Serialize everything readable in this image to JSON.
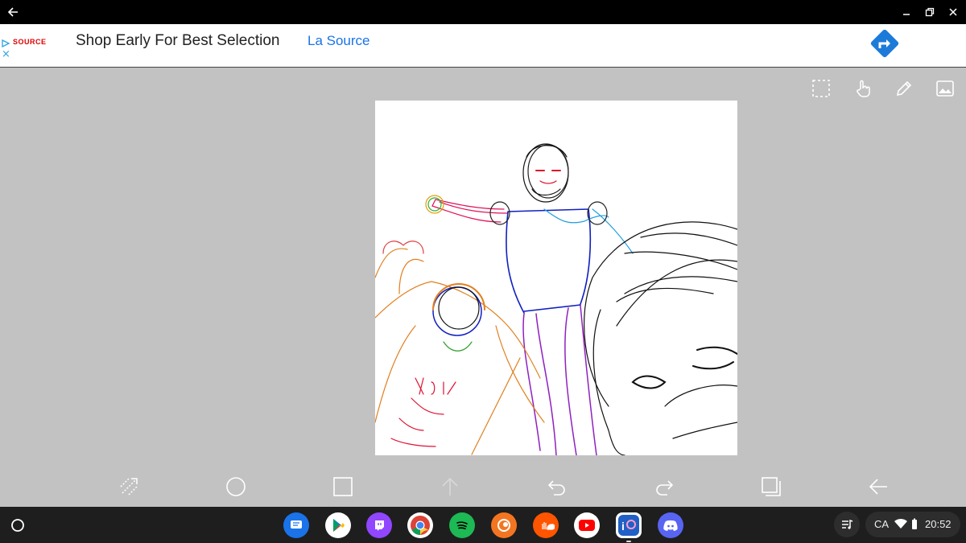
{
  "ad": {
    "brand": "SOURCE",
    "close": "×",
    "headline": "Shop Early For Best Selection",
    "advertiser": "La Source"
  },
  "tray": {
    "keyboard": "CA",
    "time": "20:52"
  },
  "colors": {
    "titlebar": "#000000",
    "canvas_bg": "#c2c2c2",
    "shelf": "#1e1e1e",
    "ad_accent": "#1a73e8",
    "cta_blue": "#1c7bd9"
  },
  "icons": {
    "top_tools": [
      "selection-icon",
      "touch-icon",
      "pencil-icon",
      "image-icon"
    ],
    "bottom_tools": [
      "transform-icon",
      "circle-icon",
      "square-icon",
      "up-arrow-icon",
      "undo-icon",
      "redo-icon",
      "layers-icon",
      "back-arrow-icon"
    ],
    "shelf_apps": [
      "messages-icon",
      "play-store-icon",
      "twitch-icon",
      "chrome-icon",
      "spotify-icon",
      "crunchyroll-icon",
      "soundcloud-icon",
      "youtube-icon",
      "ibis-paint-icon",
      "discord-icon"
    ]
  }
}
